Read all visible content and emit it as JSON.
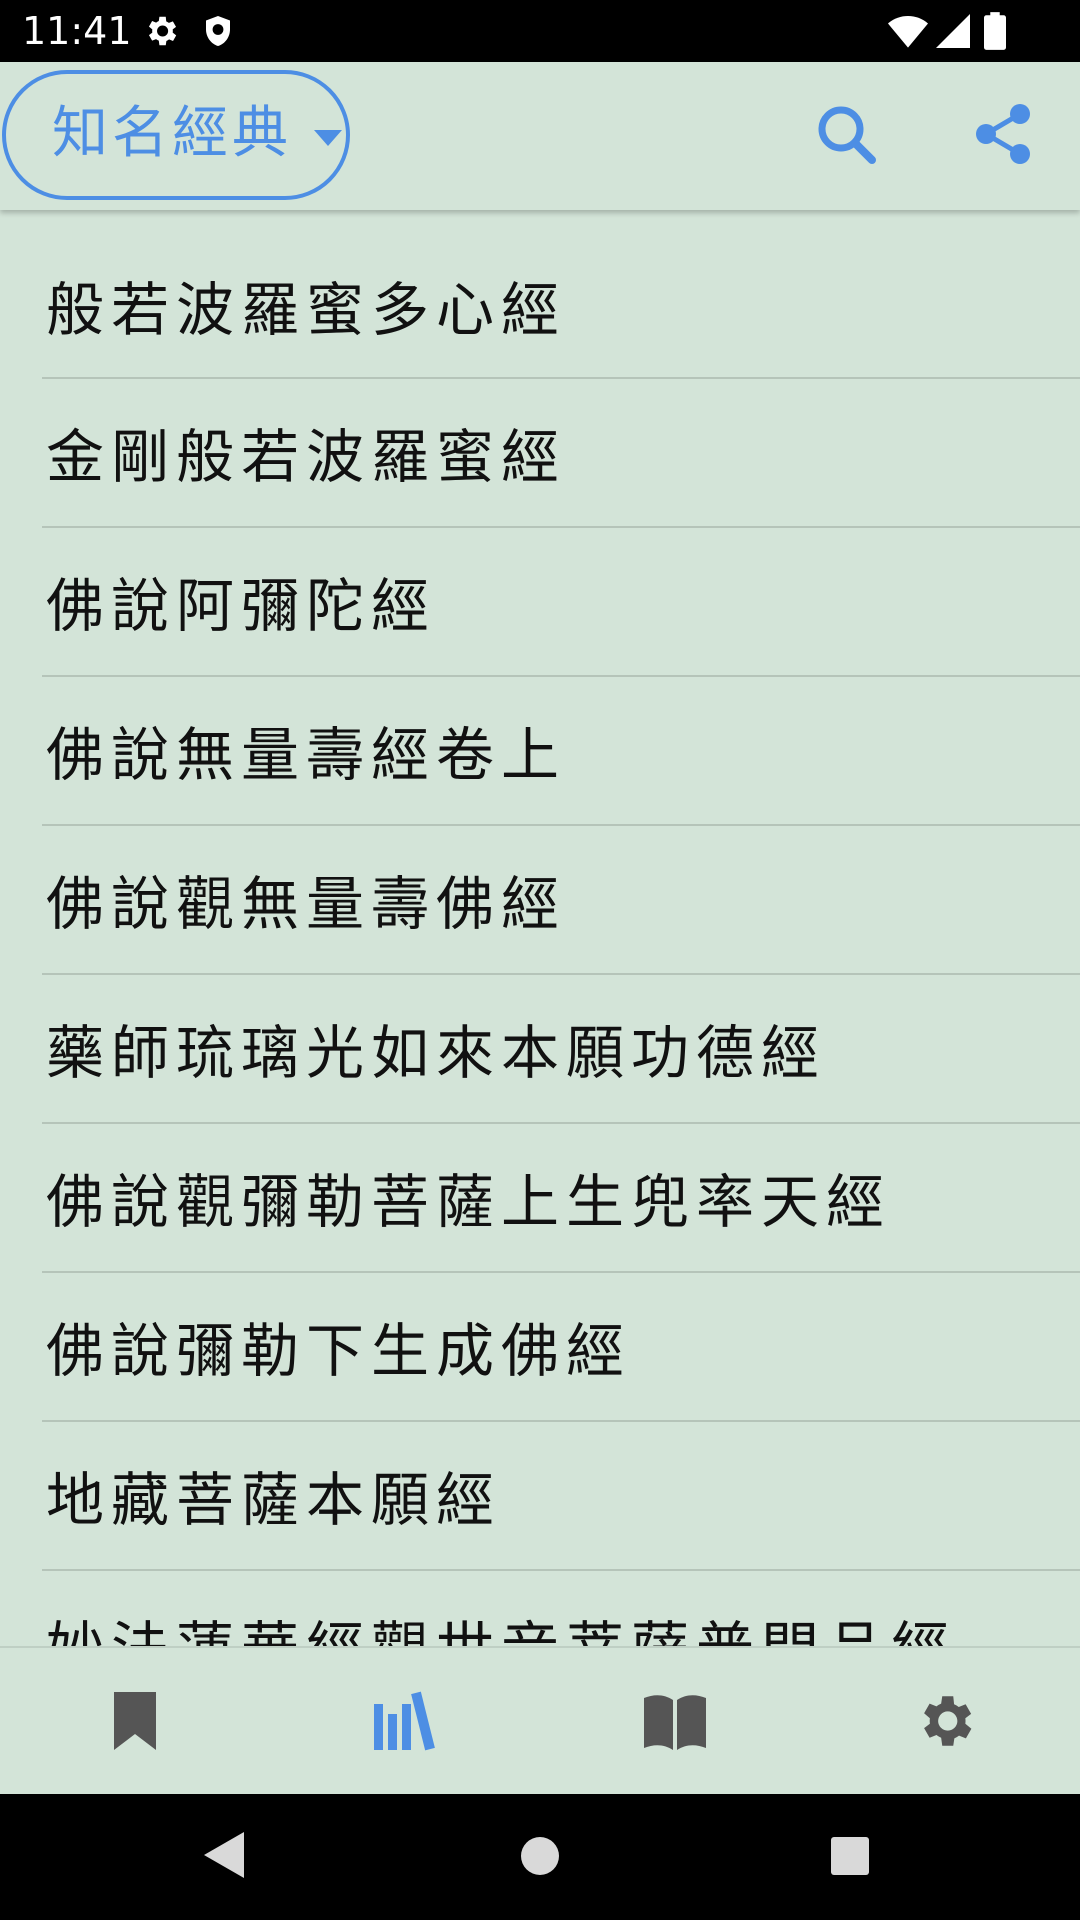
{
  "status_bar": {
    "time": "11:41",
    "icons": [
      "gear-icon",
      "shield-icon",
      "wifi-icon",
      "signal-icon",
      "battery-icon"
    ]
  },
  "app_bar": {
    "category_label": "知名經典",
    "icons": [
      "dropdown-arrow-icon",
      "search-icon",
      "share-icon"
    ],
    "accent_color": "#4d8ee4"
  },
  "sutras": [
    "般若波羅蜜多心經",
    "金剛般若波羅蜜經",
    "佛說阿彌陀經",
    "佛說無量壽經卷上",
    "佛說觀無量壽佛經",
    "藥師琉璃光如來本願功德經",
    "佛說觀彌勒菩薩上生兜率天經",
    "佛說彌勒下生成佛經",
    "地藏菩薩本願經",
    "妙法蓮華經觀世音菩薩普門品經"
  ],
  "bottom_nav": {
    "items": [
      "bookmark-icon",
      "library-icon",
      "open-book-icon",
      "settings-icon"
    ],
    "active_index": 1,
    "active_color": "#4d8ee4",
    "inactive_color": "#555555"
  },
  "system_nav": [
    "back-icon",
    "home-icon",
    "recents-icon"
  ],
  "colors": {
    "background": "#d3e4d8",
    "divider": "#b5c4b9",
    "text": "#111111"
  }
}
